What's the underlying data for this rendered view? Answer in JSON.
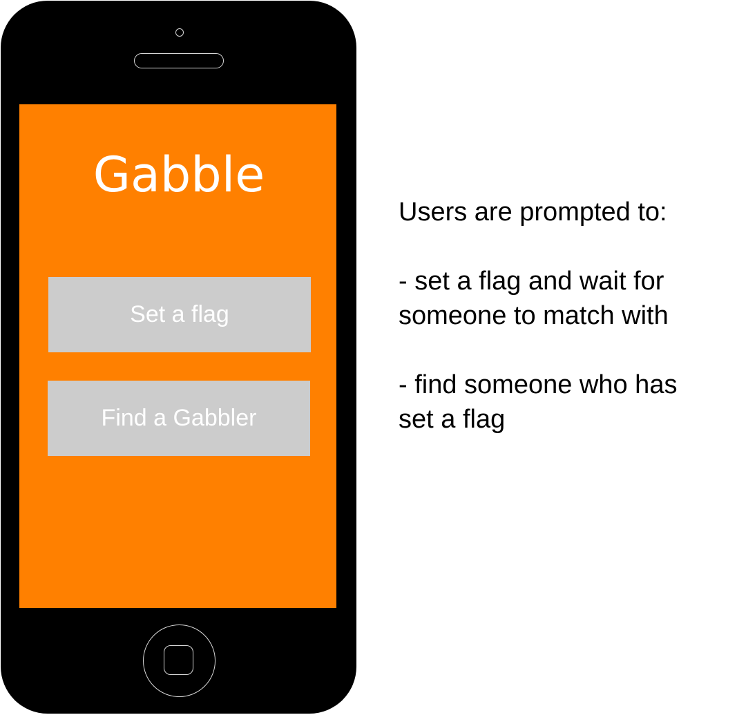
{
  "phone": {
    "app_title": "Gabble",
    "buttons": {
      "set_flag_label": "Set a flag",
      "find_gabbler_label": "Find a Gabbler"
    },
    "colors": {
      "screen_background": "#ff8000",
      "button_background": "#cccccc",
      "button_text": "#ffffff",
      "phone_body": "#000000"
    },
    "icons": [
      "camera-icon",
      "speaker-icon",
      "home-button-icon"
    ]
  },
  "notes": {
    "intro": "Users are prompted to:",
    "option1_line1": "- set a flag and wait for",
    "option1_line2": "someone to match with",
    "option2_line1": "- find someone who has",
    "option2_line2": "set a flag"
  }
}
